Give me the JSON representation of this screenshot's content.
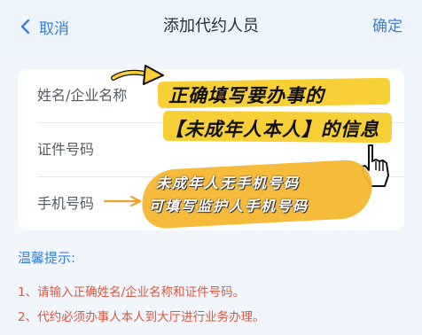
{
  "nav": {
    "back_label": "取消",
    "title": "添加代约人员",
    "confirm_label": "确定"
  },
  "form": {
    "fields": [
      {
        "label": "姓名/企业名称"
      },
      {
        "label": "证件号码"
      },
      {
        "label": "手机号码"
      }
    ]
  },
  "annotations": {
    "line1": "正确填写要办事的",
    "line2": "【未成年人本人】的信息",
    "line3": "未成年人无手机号码",
    "line4": "可填写监护人手机号码",
    "highlight_color": "#f7cf36",
    "blob_color": "#f7b731"
  },
  "tips": {
    "title": "温馨提示:",
    "items": [
      "1、请输入正确姓名/企业名称和证件号码。",
      "2、代约必须办事人本人到大厅进行业务办理。"
    ]
  },
  "colors": {
    "accent": "#3a7fd6",
    "warning": "#e0553e",
    "background": "#f1f6fc"
  },
  "icons": {
    "back": "chevron-left-icon",
    "pointer": "hand-pointer-icon"
  }
}
